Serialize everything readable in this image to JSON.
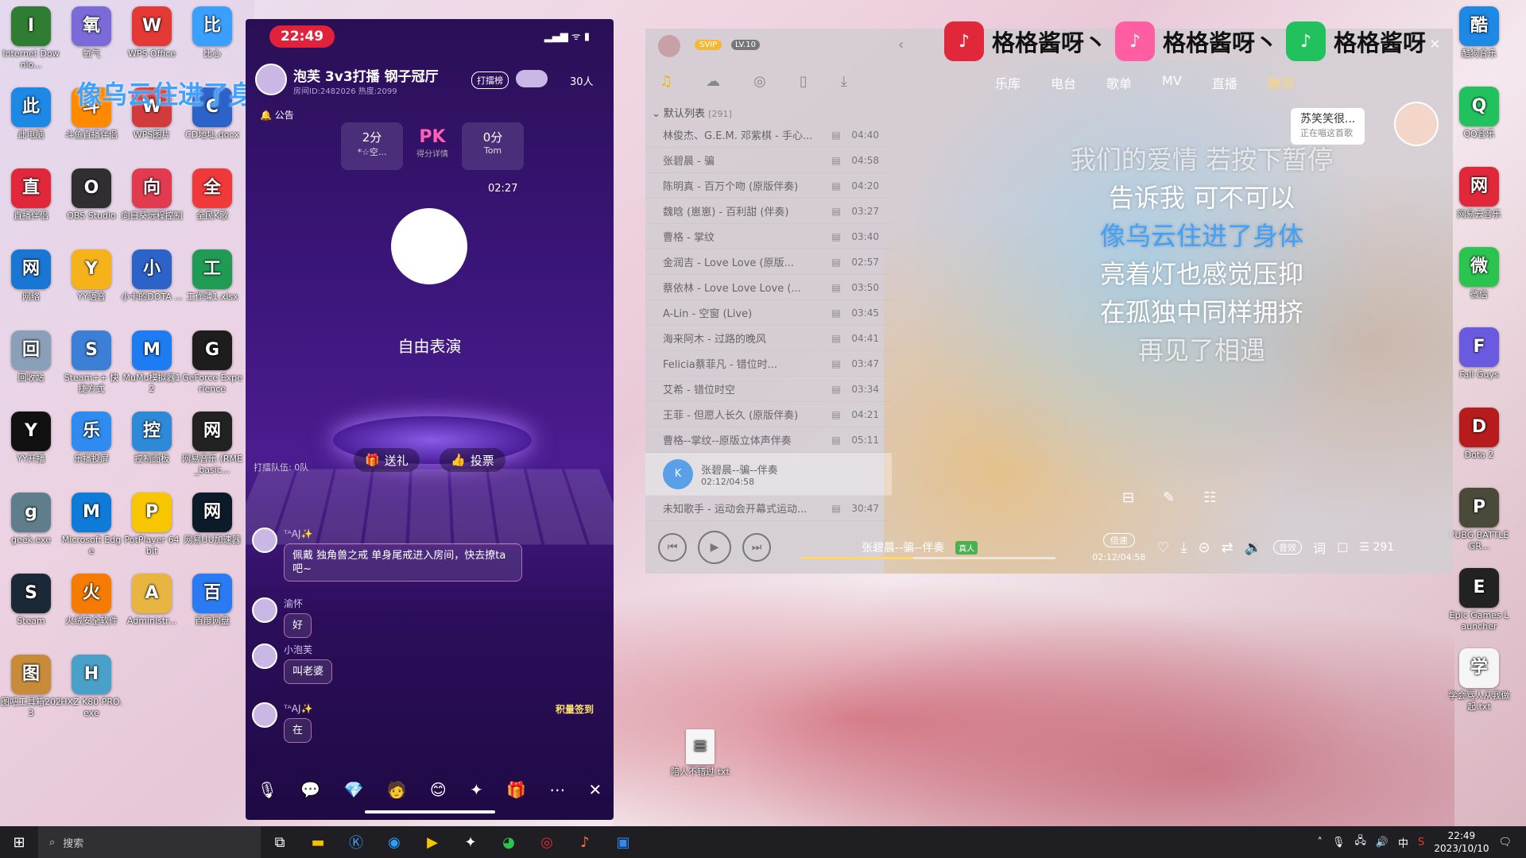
{
  "desktop": {
    "left_icons": [
      {
        "label": "Internet Downlo...",
        "icon": "earth-icon",
        "color": "#2e7d32"
      },
      {
        "label": "氧气",
        "icon": "oxygen-icon",
        "color": "#7b6bd8"
      },
      {
        "label": "WPS Office",
        "icon": "wps-icon",
        "color": "#e53935"
      },
      {
        "label": "比心",
        "icon": "bixin-icon",
        "color": "#3aa0ff"
      },
      {
        "label": "此电脑",
        "icon": "computer-icon",
        "color": "#1e88e5"
      },
      {
        "label": "斗鱼直播伴侣",
        "icon": "douyu-icon",
        "color": "#ff8a00"
      },
      {
        "label": "WPS图片",
        "icon": "wps-pic-icon",
        "color": "#d23b3b"
      },
      {
        "label": "CD地址.docx",
        "icon": "docx-icon",
        "color": "#2b63c8"
      },
      {
        "label": "直播伴侣",
        "icon": "live-icon",
        "color": "#e0283a"
      },
      {
        "label": "OBS Studio",
        "icon": "obs-icon",
        "color": "#302e31"
      },
      {
        "label": "向日葵远程控制",
        "icon": "sunflower-icon",
        "color": "#e23a4e"
      },
      {
        "label": "全民K歌",
        "icon": "kge-icon",
        "color": "#f03a3a"
      },
      {
        "label": "网络",
        "icon": "network-icon",
        "color": "#1976d2"
      },
      {
        "label": "YY语音",
        "icon": "yy-icon",
        "color": "#f6b21b"
      },
      {
        "label": "小卡的DOTA ...",
        "icon": "word-icon",
        "color": "#2b63c8"
      },
      {
        "label": "工作薄1.xlsx",
        "icon": "excel-icon",
        "color": "#1f9b55"
      },
      {
        "label": "回收站",
        "icon": "recycle-icon",
        "color": "#8aa0b8"
      },
      {
        "label": "Steam++ 快捷方式",
        "icon": "steampp-icon",
        "color": "#3b7fd6"
      },
      {
        "label": "MuMu模拟器12",
        "icon": "mumu-icon",
        "color": "#1d7cf2"
      },
      {
        "label": "GeForce Experience",
        "icon": "nvidia-icon",
        "color": "#1d1d1d"
      },
      {
        "label": "YY开播",
        "icon": "yykb-icon",
        "color": "#111111"
      },
      {
        "label": "乐播投屏",
        "icon": "lebo-icon",
        "color": "#2f8bf0"
      },
      {
        "label": "控制面板",
        "icon": "control-panel-icon",
        "color": "#2e8ad8"
      },
      {
        "label": "网易音乐 (RME_basic...",
        "icon": "rme-icon",
        "color": "#222222"
      },
      {
        "label": "geek.exe",
        "icon": "geek-icon",
        "color": "#607d8b"
      },
      {
        "label": "Microsoft Edge",
        "icon": "edge-icon",
        "color": "#0f7bd8"
      },
      {
        "label": "PotPlayer 64 bit",
        "icon": "potplayer-icon",
        "color": "#f7c600"
      },
      {
        "label": "网易UU加速器",
        "icon": "uu-icon",
        "color": "#0c1a2a"
      },
      {
        "label": "Steam",
        "icon": "steam-icon",
        "color": "#1b2838"
      },
      {
        "label": "火绒安全软件",
        "icon": "huorong-icon",
        "color": "#f57c00"
      },
      {
        "label": "Administr...",
        "icon": "user-folder-icon",
        "color": "#e8b640"
      },
      {
        "label": "百度网盘",
        "icon": "baidu-icon",
        "color": "#2a7bf3"
      },
      {
        "label": "图吧工具箱2023",
        "icon": "toolbox-icon",
        "color": "#c88b3a"
      },
      {
        "label": "HXZ K80 PRO.exe",
        "icon": "exe-icon",
        "color": "#49a0c8"
      }
    ],
    "right_icons": [
      {
        "label": "酷狗音乐",
        "icon": "kugou-icon",
        "color": "#1e88e5"
      },
      {
        "label": "QQ音乐",
        "icon": "qqmusic-icon",
        "color": "#21c25e"
      },
      {
        "label": "网易云音乐",
        "icon": "netease-icon",
        "color": "#e0283a"
      },
      {
        "label": "微信",
        "icon": "wechat-icon",
        "color": "#2bc44e"
      },
      {
        "label": "Fall Guys",
        "icon": "fallguys-icon",
        "color": "#6a5ae0"
      },
      {
        "label": "Dota 2",
        "icon": "dota-icon",
        "color": "#b71c1c"
      },
      {
        "label": "PUBG BATTLEGR...",
        "icon": "pubg-icon",
        "color": "#4a4a3a"
      },
      {
        "label": "Epic Games Launcher",
        "icon": "epic-icon",
        "color": "#222222"
      },
      {
        "label": "学会骂人从我做起.txt",
        "icon": "txt-icon",
        "color": "#f5f5f5"
      }
    ],
    "bottom_file": {
      "label": "陪人不错过.txt",
      "icon": "txt-icon"
    }
  },
  "karaoke_overlay": "像乌云住进了身体",
  "brand_overlay": [
    {
      "text": "格格酱呀丶",
      "icon": "netease-icon",
      "color": "#e0283a"
    },
    {
      "text": "格格酱呀丶",
      "icon": "bilibili-icon",
      "color": "#ff5fa2"
    },
    {
      "text": "格格酱呀",
      "icon": "qqmusic-icon",
      "color": "#21c25e"
    }
  ],
  "phone": {
    "status_time": "22:49",
    "room_title": "泡芙 3v3打播 钢子冠厅",
    "room_sub": "房间ID:2482026 热度:2099",
    "rank_badge": "打擂榜",
    "online_count": "30人",
    "notice": "公告",
    "pk": {
      "left_score": "2分",
      "left_name": "*☆空...",
      "mid": "PK",
      "mid_sub": "得分详情",
      "right_score": "0分",
      "right_name": "Tom"
    },
    "timer": "02:27",
    "stage_text": "自由表演",
    "gift_btn": "送礼",
    "vote_btn": "投票",
    "queue": "打擂队伍: 0队",
    "chat": [
      {
        "name": "ᵀᴬAJ✨",
        "text": "佩戴 独角兽之戒 单身尾戒进入房间，快去撩ta吧~"
      },
      {
        "name": "渝怀",
        "text": "好"
      },
      {
        "name": "小泡芙",
        "text": "叫老婆"
      },
      {
        "name": "ᵀᴬAJ✨",
        "text": "在"
      }
    ],
    "sign_in": "积量签到"
  },
  "music": {
    "vip": "SVIP",
    "level": "LV.10",
    "tabs": [
      "乐库",
      "电台",
      "歌单",
      "MV",
      "直播",
      "歌词"
    ],
    "active_tab": "歌词",
    "playlist_label": "默认列表",
    "playlist_count": "[291]",
    "songs": [
      {
        "name": "林俊杰、G.E.M. 邓紫棋 - 手心...",
        "dur": "04:40"
      },
      {
        "name": "张碧晨 - 骗",
        "dur": "04:58"
      },
      {
        "name": "陈明真 - 百万个吻 (原版伴奏)",
        "dur": "04:20"
      },
      {
        "name": "魏晗 (崽崽) - 百利甜 (伴奏)",
        "dur": "03:27"
      },
      {
        "name": "曹格 - 掌纹",
        "dur": "03:40"
      },
      {
        "name": "金润吉 - Love Love (原版...",
        "dur": "02:57"
      },
      {
        "name": "蔡依林 - Love Love Love (...",
        "dur": "03:50"
      },
      {
        "name": "A-Lin - 空窗 (Live)",
        "dur": "03:45"
      },
      {
        "name": "海来阿木 - 过路的晚风",
        "dur": "04:41"
      },
      {
        "name": "Felicia蔡菲凡 - 错位时...",
        "dur": "03:47"
      },
      {
        "name": "艾希 - 错位时空",
        "dur": "03:34"
      },
      {
        "name": "王菲 - 但愿人长久 (原版伴奏)",
        "dur": "04:21"
      },
      {
        "name": "曹格--掌纹--原版立体声伴奏",
        "dur": "05:11"
      }
    ],
    "now_playing": {
      "name": "张碧晨--骗--伴奏",
      "time": "02:12/04:58"
    },
    "next_song": {
      "name": "未知歌手 - 运动会开幕式运动...",
      "dur": "30:47"
    },
    "lyrics": [
      "我们的爱情 若按下暂停",
      "告诉我 可不可以",
      "像乌云住进了身体",
      "亮着灯也感觉压抑",
      "在孤独中同样拥挤",
      "再见了相遇"
    ],
    "singer_bubble": {
      "name": "苏笑笑很...",
      "status": "正在唱这首歌"
    },
    "bar_title": "张碧晨--骗--伴奏",
    "bar_badge": "真人",
    "bar_time": "02:12/04:58",
    "speed": "倍速",
    "effect": "音效",
    "lyric_btn": "词",
    "queue_count": "291",
    "progress": 0.44
  },
  "taskbar": {
    "search_placeholder": "搜索",
    "time": "22:49",
    "date": "2023/10/10",
    "ime": "中"
  }
}
